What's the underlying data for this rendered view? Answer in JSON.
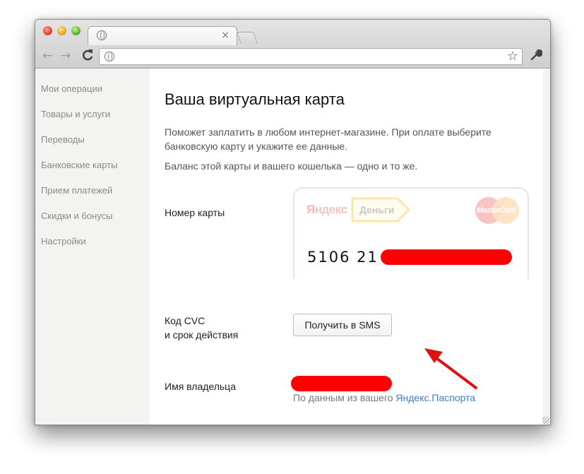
{
  "browser": {
    "tab_close": "×",
    "url": "",
    "back_icon": "←",
    "forward_icon": "→",
    "reload_icon": "C",
    "star_icon": "☆",
    "wrench_icon": "🔧"
  },
  "sidebar": {
    "items": [
      {
        "label": "Мои операции"
      },
      {
        "label": "Товары и услуги"
      },
      {
        "label": "Переводы"
      },
      {
        "label": "Банковские карты"
      },
      {
        "label": "Прием платежей"
      },
      {
        "label": "Скидки и бонусы"
      },
      {
        "label": "Настройки"
      }
    ]
  },
  "main": {
    "title": "Ваша виртуальная карта",
    "description_1": "Поможет заплатить в любом интернет-магазине. При оплате выберите банковскую карту и укажите ее данные.",
    "description_2": "Баланс этой карты и вашего кошелька — одно и то же.",
    "card_number_label": "Номер карты",
    "card": {
      "brand_first": "Я",
      "brand_rest": "ндекс",
      "money": "Деньги",
      "network": "MasterCard",
      "number_visible": "5106  21"
    },
    "cvc_label_line1": "Код CVC",
    "cvc_label_line2": "и срок действия",
    "sms_button": "Получить в SMS",
    "owner_label": "Имя владельца",
    "owner_note_prefix": "По данным из вашего ",
    "owner_note_link": "Яндекс.Паспорта"
  },
  "colors": {
    "redaction": "#ff0000",
    "link": "#3d7cc9",
    "arrow": "#e01010"
  }
}
